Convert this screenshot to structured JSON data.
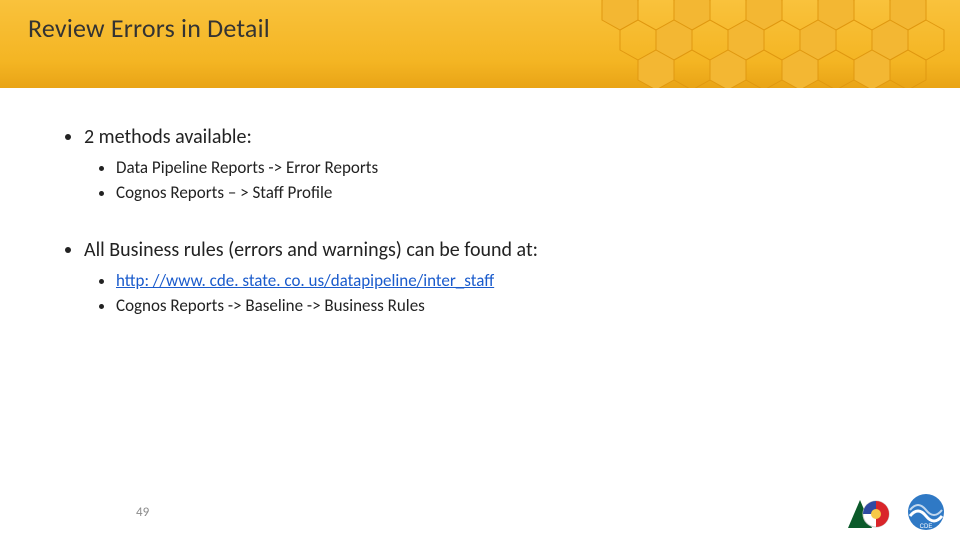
{
  "title": "Review Errors in Detail",
  "bullets": {
    "item1": {
      "main": "2 methods available:",
      "sub1": "Data Pipeline Reports -> Error Reports",
      "sub2": "Cognos Reports – > Staff Profile"
    },
    "item2": {
      "main": "All Business rules (errors and warnings) can be found at:",
      "link": "http: //www. cde. state. co. us/datapipeline/inter_staff",
      "sub2": "Cognos Reports -> Baseline -> Business Rules"
    }
  },
  "pageNumber": "49",
  "colors": {
    "headerTop": "#f9c23c",
    "headerBottom": "#e9a416",
    "link": "#1a5bcc"
  }
}
